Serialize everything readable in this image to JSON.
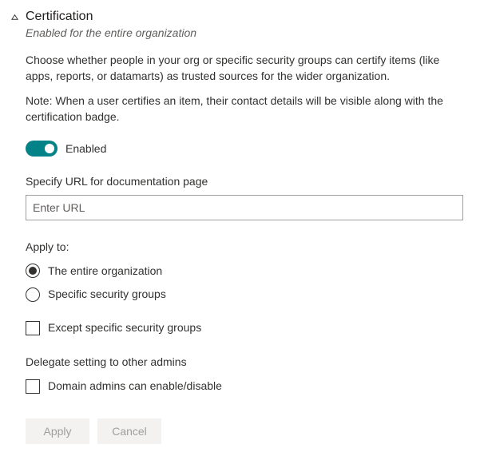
{
  "header": {
    "title": "Certification",
    "subtitle": "Enabled for the entire organization",
    "description": "Choose whether people in your org or specific security groups can certify items (like apps, reports, or datamarts) as trusted sources for the wider organization.",
    "note": "Note: When a user certifies an item, their contact details will be visible along with the certification badge."
  },
  "toggle": {
    "state": "on",
    "label": "Enabled"
  },
  "url_field": {
    "label": "Specify URL for documentation page",
    "placeholder": "Enter URL",
    "value": ""
  },
  "apply_to": {
    "label": "Apply to:",
    "options": [
      {
        "label": "The entire organization",
        "selected": true
      },
      {
        "label": "Specific security groups",
        "selected": false
      }
    ],
    "except_label": "Except specific security groups",
    "except_checked": false
  },
  "delegate": {
    "label": "Delegate setting to other admins",
    "option_label": "Domain admins can enable/disable",
    "checked": false
  },
  "buttons": {
    "apply": "Apply",
    "cancel": "Cancel"
  }
}
